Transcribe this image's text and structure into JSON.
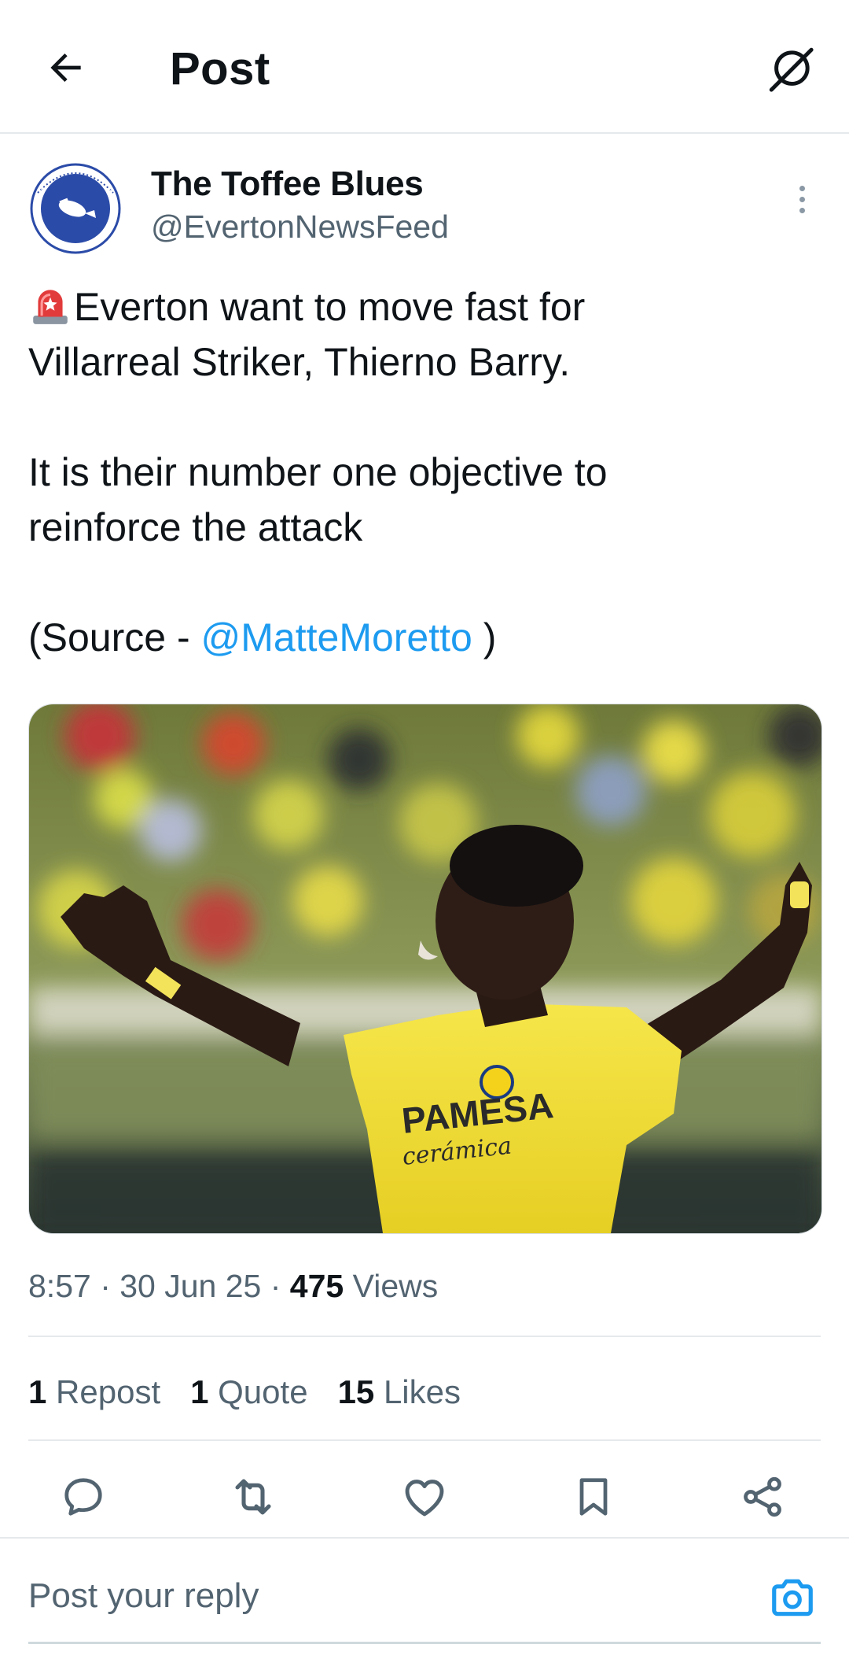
{
  "header": {
    "title": "Post",
    "back_icon": "arrow-left-icon",
    "grok_icon": "grok-icon"
  },
  "author": {
    "name": "The Toffee Blues",
    "handle": "@EvertonNewsFeed",
    "avatar_text_top": "The Toffee Blues",
    "avatar_text_bottom": "2011",
    "avatar_color": "#2b4ba8"
  },
  "post": {
    "line1": "Everton want to move fast for",
    "line2": "Villarreal Striker, Thierno Barry.",
    "line3": "It is their number one objective to",
    "line4": "reinforce the attack",
    "source_prefix": "(Source - ",
    "source_mention": "@MatteMoretto",
    "source_suffix": " )",
    "siren_icon": "rotating-light-emoji",
    "image": {
      "jersey_sponsor": "PAMESA",
      "jersey_sponsor_sub": "cerámica",
      "shirt_color": "#f3e03a"
    }
  },
  "meta": {
    "time": "8:57",
    "date": "30 Jun 25",
    "views_count": "475",
    "views_label": "Views"
  },
  "stats": {
    "reposts_count": "1",
    "reposts_label": "Repost",
    "quotes_count": "1",
    "quotes_label": "Quote",
    "likes_count": "15",
    "likes_label": "Likes"
  },
  "reply": {
    "placeholder": "Post your reply"
  },
  "colors": {
    "accent": "#1d9bf0",
    "secondary_text": "#536471",
    "divider": "#e6e9ec"
  }
}
